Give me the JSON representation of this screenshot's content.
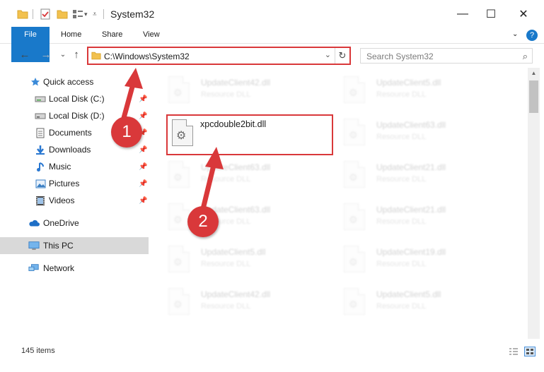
{
  "window": {
    "title": "System32",
    "minimize": "—",
    "maximize": "☐",
    "close": "✕"
  },
  "ribbon": {
    "tabs": [
      "File",
      "Home",
      "Share",
      "View"
    ],
    "help": "?"
  },
  "address": {
    "path": "C:\\Windows\\System32",
    "dropdown": "⌄",
    "refresh": "↻",
    "back": "←",
    "forward": "→",
    "recent": "⌄",
    "up": "↑"
  },
  "search": {
    "placeholder": "Search System32",
    "icon": "⌕"
  },
  "sidebar": {
    "items": [
      {
        "label": "Quick access",
        "icon": "star-icon"
      },
      {
        "label": "Local Disk (C:)",
        "icon": "drive-icon",
        "pinned": true
      },
      {
        "label": "Local Disk (D:)",
        "icon": "drive-icon",
        "pinned": true
      },
      {
        "label": "Documents",
        "icon": "document-icon",
        "pinned": true
      },
      {
        "label": "Downloads",
        "icon": "download-icon",
        "pinned": true
      },
      {
        "label": "Music",
        "icon": "music-icon",
        "pinned": true
      },
      {
        "label": "Pictures",
        "icon": "pictures-icon",
        "pinned": true
      },
      {
        "label": "Videos",
        "icon": "video-icon",
        "pinned": true
      },
      {
        "label": "OneDrive",
        "icon": "cloud-icon"
      },
      {
        "label": "This PC",
        "icon": "computer-icon",
        "selected": true
      },
      {
        "label": "Network",
        "icon": "network-icon"
      }
    ]
  },
  "files": {
    "highlighted": {
      "name": "xpcdouble2bit.dll"
    },
    "left": [
      {
        "name": "UpdateClient42.dll",
        "type": "Resource DLL"
      },
      {
        "name": "UpdateClient63.dll",
        "type": "Resource DLL"
      },
      {
        "name": "UpdateClient63.dll",
        "type": "Resource DLL"
      },
      {
        "name": "UpdateClient5.dll",
        "type": "Resource DLL"
      },
      {
        "name": "UpdateClient42.dll",
        "type": "Resource DLL"
      }
    ],
    "right": [
      {
        "name": "UpdateClient5.dll",
        "type": "Resource DLL"
      },
      {
        "name": "UpdateClient63.dll",
        "type": "Resource DLL"
      },
      {
        "name": "UpdateClient21.dll",
        "type": "Resource DLL"
      },
      {
        "name": "UpdateClient21.dll",
        "type": "Resource DLL"
      },
      {
        "name": "UpdateClient19.dll",
        "type": "Resource DLL"
      },
      {
        "name": "UpdateClient5.dll",
        "type": "Resource DLL"
      }
    ]
  },
  "status": {
    "item_count": "145 items"
  },
  "annotations": {
    "step1": "1",
    "step2": "2",
    "color": "#d9383a"
  },
  "colors": {
    "accent": "#1979ca",
    "highlight": "#d9383a",
    "folder": "#f2c14e"
  }
}
